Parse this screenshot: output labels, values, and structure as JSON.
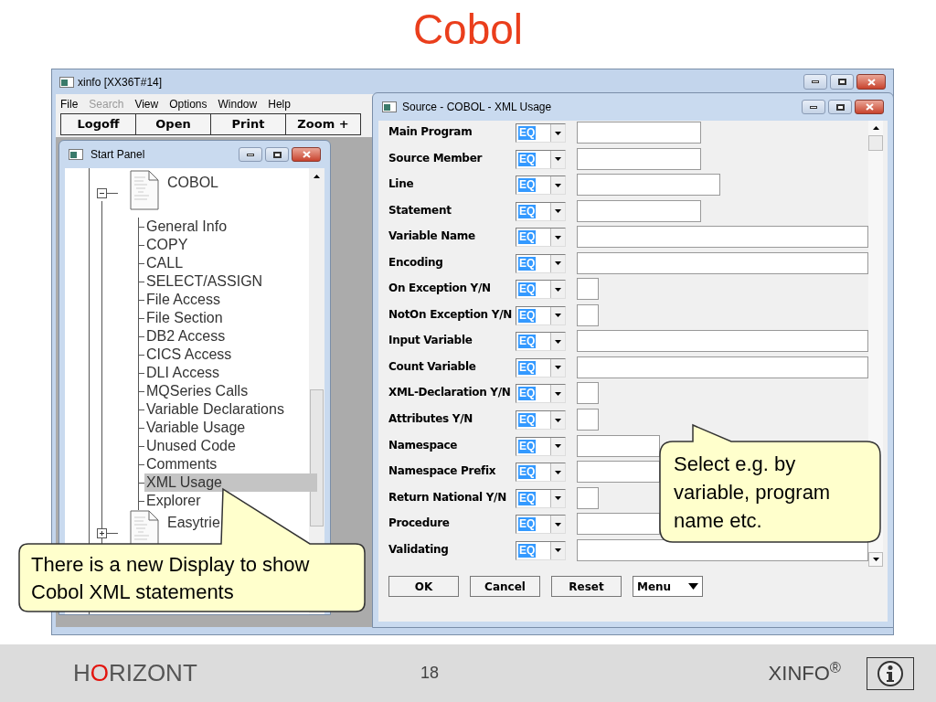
{
  "slide_title": "Cobol",
  "main_window": {
    "title": "xinfo [XX36T#14]",
    "menu": [
      {
        "label": "File",
        "disabled": false
      },
      {
        "label": "Search",
        "disabled": true
      },
      {
        "label": "View",
        "disabled": false
      },
      {
        "label": "Options",
        "disabled": false
      },
      {
        "label": "Window",
        "disabled": false
      },
      {
        "label": "Help",
        "disabled": false
      }
    ],
    "toolbar": [
      "Logoff",
      "Open",
      "Print",
      "Zoom +"
    ]
  },
  "start_panel": {
    "title": "Start Panel",
    "tree": [
      {
        "label": "COBOL",
        "expanded": true,
        "children": [
          {
            "label": "General Info",
            "selected": false
          },
          {
            "label": "COPY",
            "selected": false
          },
          {
            "label": "CALL",
            "selected": false
          },
          {
            "label": "SELECT/ASSIGN",
            "selected": false
          },
          {
            "label": "File Access",
            "selected": false
          },
          {
            "label": "File Section",
            "selected": false
          },
          {
            "label": "DB2 Access",
            "selected": false
          },
          {
            "label": "CICS Access",
            "selected": false
          },
          {
            "label": "DLI Access",
            "selected": false
          },
          {
            "label": "MQSeries Calls",
            "selected": false
          },
          {
            "label": "Variable Declarations",
            "selected": false
          },
          {
            "label": "Variable Usage",
            "selected": false
          },
          {
            "label": "Unused Code",
            "selected": false
          },
          {
            "label": "Comments",
            "selected": false
          },
          {
            "label": "XML Usage",
            "selected": true
          },
          {
            "label": "Explorer",
            "selected": false
          }
        ]
      },
      {
        "label": "Easytrie",
        "expanded": false
      }
    ]
  },
  "source_window": {
    "title": "Source - COBOL - XML Usage",
    "fields": [
      {
        "label": "Main Program",
        "operator": "EQ",
        "kind": "short"
      },
      {
        "label": "Source Member",
        "operator": "EQ",
        "kind": "short"
      },
      {
        "label": "Line",
        "operator": "EQ",
        "kind": "medium"
      },
      {
        "label": "Statement",
        "operator": "EQ",
        "kind": "short"
      },
      {
        "label": "Variable Name",
        "operator": "EQ",
        "kind": "long"
      },
      {
        "label": "Encoding",
        "operator": "EQ",
        "kind": "long"
      },
      {
        "label": "On Exception Y/N",
        "operator": "EQ",
        "kind": "flag"
      },
      {
        "label": "NotOn Exception Y/N",
        "operator": "EQ",
        "kind": "flag"
      },
      {
        "label": "Input Variable",
        "operator": "EQ",
        "kind": "long"
      },
      {
        "label": "Count Variable",
        "operator": "EQ",
        "kind": "long"
      },
      {
        "label": "XML-Declaration Y/N",
        "operator": "EQ",
        "kind": "flag"
      },
      {
        "label": "Attributes Y/N",
        "operator": "EQ",
        "kind": "flag"
      },
      {
        "label": "Namespace",
        "operator": "EQ",
        "kind": "covered"
      },
      {
        "label": "Namespace Prefix",
        "operator": "EQ",
        "kind": "covered"
      },
      {
        "label": "Return National Y/N",
        "operator": "EQ",
        "kind": "flag"
      },
      {
        "label": "Procedure",
        "operator": "EQ",
        "kind": "covered"
      },
      {
        "label": "Validating",
        "operator": "EQ",
        "kind": "long"
      }
    ],
    "buttons": [
      {
        "label": "OK",
        "kind": "plain"
      },
      {
        "label": "Cancel",
        "kind": "plain"
      },
      {
        "label": "Reset",
        "kind": "plain"
      },
      {
        "label": "Menu",
        "kind": "dropdown"
      }
    ]
  },
  "callouts": [
    {
      "text": "There is a new Display to show Cobol XML statements"
    },
    {
      "text": "Select e.g. by variable, program name etc."
    }
  ],
  "footer": {
    "logo_start": "H",
    "logo_accent": "O",
    "logo_end": "RIZONT",
    "page_number": "18",
    "product": "XINFO$^{®}$"
  }
}
